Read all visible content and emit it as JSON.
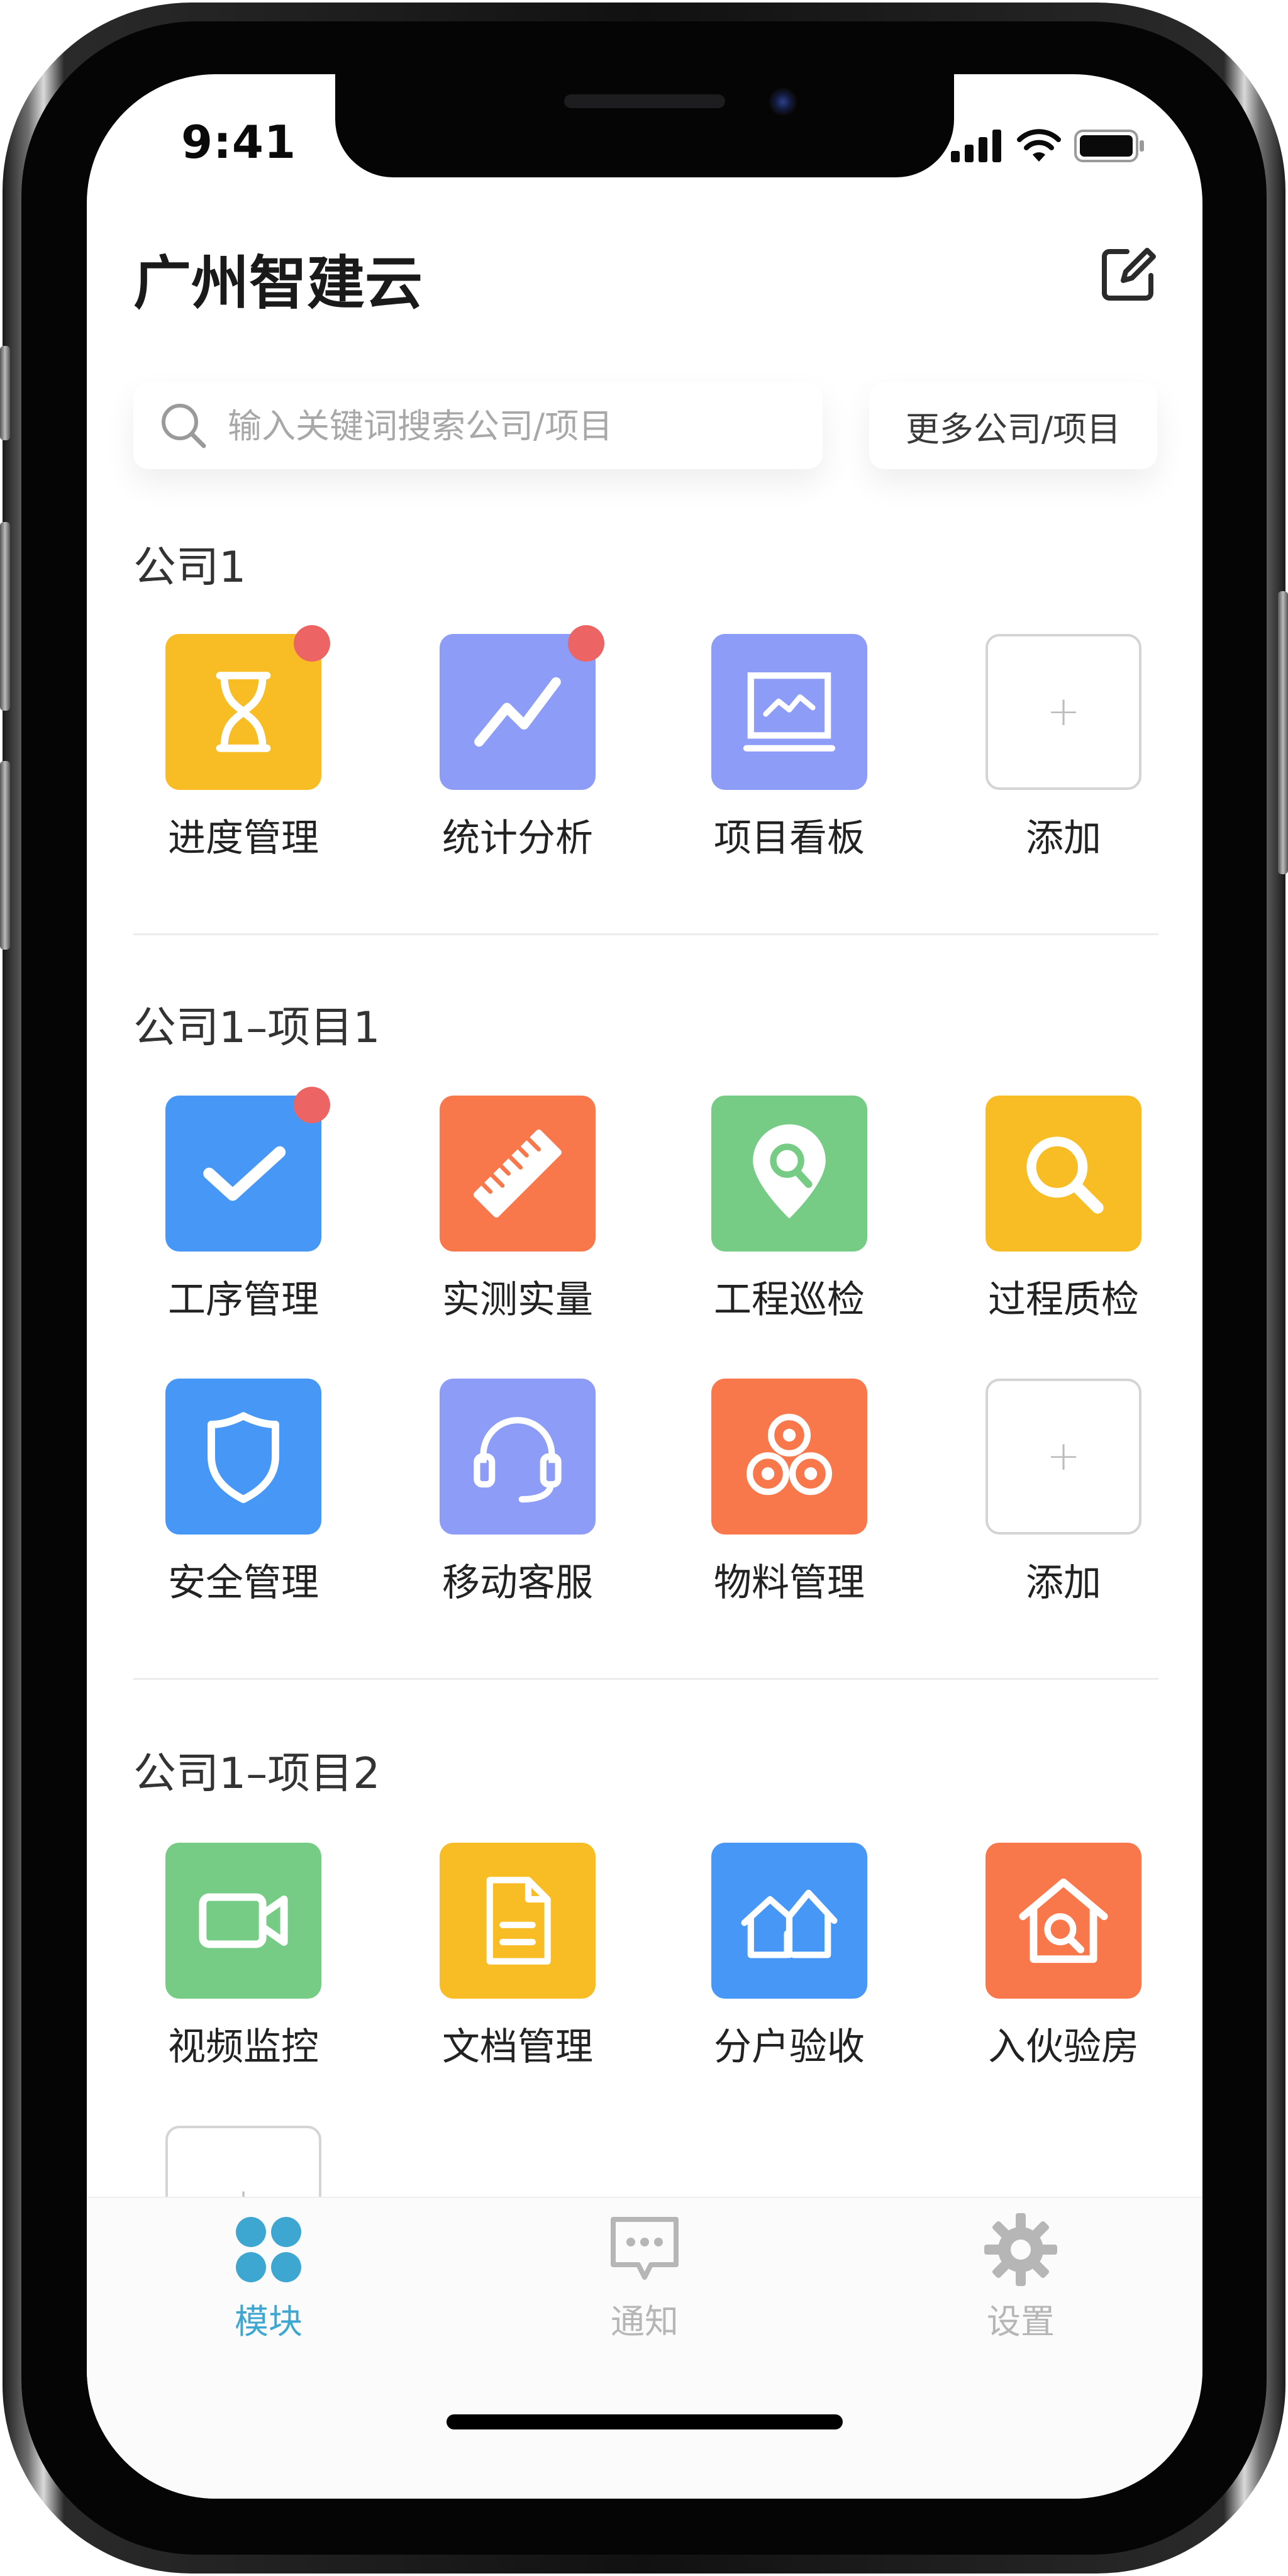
{
  "status_bar": {
    "time": "9:41"
  },
  "header": {
    "title": "广州智建云"
  },
  "search": {
    "placeholder": "输入关键词搜索公司/项目",
    "more_label": "更多公司/项目"
  },
  "sections": [
    {
      "title": "公司1",
      "tiles": [
        {
          "label": "进度管理",
          "color": "#f8bd24",
          "icon": "hourglass-icon",
          "badge": true
        },
        {
          "label": "统计分析",
          "color": "#8d9cf7",
          "icon": "trend-line-icon",
          "badge": true
        },
        {
          "label": "项目看板",
          "color": "#8d9cf7",
          "icon": "monitor-chart-icon",
          "badge": false
        },
        {
          "label": "添加",
          "icon": "plus-icon",
          "add": true
        }
      ]
    },
    {
      "title": "公司1–项目1",
      "tiles": [
        {
          "label": "工序管理",
          "color": "#4797f7",
          "icon": "checkmark-icon",
          "badge": true
        },
        {
          "label": "实测实量",
          "color": "#f8784c",
          "icon": "ruler-icon",
          "badge": false
        },
        {
          "label": "工程巡检",
          "color": "#77cc85",
          "icon": "map-pin-search-icon",
          "badge": false
        },
        {
          "label": "过程质检",
          "color": "#f8bd24",
          "icon": "magnifier-icon",
          "badge": false
        },
        {
          "label": "安全管理",
          "color": "#4797f7",
          "icon": "shield-icon",
          "badge": false
        },
        {
          "label": "移动客服",
          "color": "#8d9cf7",
          "icon": "headset-icon",
          "badge": false
        },
        {
          "label": "物料管理",
          "color": "#f8784c",
          "icon": "material-rolls-icon",
          "badge": false
        },
        {
          "label": "添加",
          "icon": "plus-icon",
          "add": true
        }
      ]
    },
    {
      "title": "公司1–项目2",
      "tiles": [
        {
          "label": "视频监控",
          "color": "#77cc85",
          "icon": "video-camera-icon",
          "badge": false
        },
        {
          "label": "文档管理",
          "color": "#f8bd24",
          "icon": "document-icon",
          "badge": false
        },
        {
          "label": "分户验收",
          "color": "#4797f7",
          "icon": "houses-icon",
          "badge": false
        },
        {
          "label": "入伙验房",
          "color": "#f8784c",
          "icon": "house-search-icon",
          "badge": false
        },
        {
          "label": "",
          "icon": "plus-icon",
          "add": true
        }
      ]
    }
  ],
  "tabbar": {
    "tabs": [
      {
        "label": "模块",
        "icon": "grid-dots-icon",
        "active": true
      },
      {
        "label": "通知",
        "icon": "chat-bubble-icon",
        "active": false
      },
      {
        "label": "设置",
        "icon": "gear-icon",
        "active": false
      }
    ],
    "active_color": "#3da7d2",
    "inactive_color": "#b6b6b6"
  }
}
